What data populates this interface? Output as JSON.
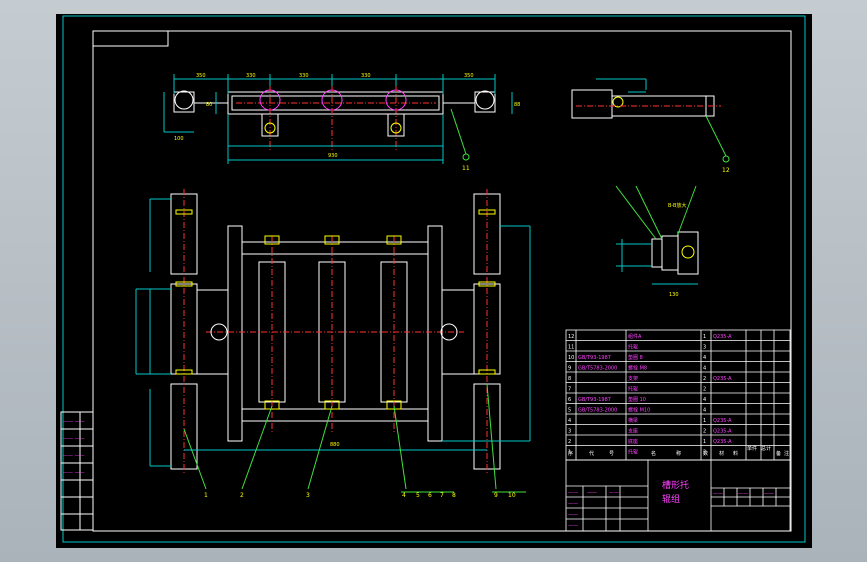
{
  "title_block": {
    "drawing_title_line1": "槽形托",
    "drawing_title_line2": "辊组"
  },
  "parts_list": {
    "header": [
      "序",
      "代",
      "号",
      "名",
      "称",
      "数",
      "材",
      "料",
      "单件",
      "总计",
      "备",
      "注"
    ],
    "rows": [
      {
        "no": "12",
        "code": "",
        "name": "组件A",
        "qty": "1",
        "material": "Q235-A"
      },
      {
        "no": "11",
        "code": "",
        "name": "托辊",
        "qty": "3",
        "material": ""
      },
      {
        "no": "10",
        "code": "GB/T93-1987",
        "name": "垫圈 8",
        "qty": "4",
        "material": ""
      },
      {
        "no": "9",
        "code": "GB/T5783-2000",
        "name": "螺栓 M8",
        "qty": "4",
        "material": ""
      },
      {
        "no": "8",
        "code": "",
        "name": "支架",
        "qty": "2",
        "material": "Q235-A"
      },
      {
        "no": "7",
        "code": "",
        "name": "托辊",
        "qty": "2",
        "material": ""
      },
      {
        "no": "6",
        "code": "GB/T93-1987",
        "name": "垫圈 10",
        "qty": "4",
        "material": ""
      },
      {
        "no": "5",
        "code": "GB/T5783-2000",
        "name": "螺栓 M10",
        "qty": "4",
        "material": ""
      },
      {
        "no": "4",
        "code": "",
        "name": "横梁",
        "qty": "1",
        "material": "Q235-A"
      },
      {
        "no": "3",
        "code": "",
        "name": "支座",
        "qty": "2",
        "material": "Q235-A"
      },
      {
        "no": "2",
        "code": "",
        "name": "底座",
        "qty": "1",
        "material": "Q235-A"
      },
      {
        "no": "1",
        "code": "",
        "name": "托辊",
        "qty": "2",
        "material": ""
      }
    ]
  },
  "balloons": [
    "1",
    "2",
    "3",
    "4",
    "5",
    "6",
    "7",
    "8",
    "9",
    "10",
    "11",
    "12"
  ],
  "dimensions": {
    "top_view": [
      "350",
      "330",
      "330",
      "330",
      "350",
      "100",
      "80",
      "88"
    ],
    "top_view_total": "930",
    "side_view": [
      "130"
    ],
    "section_label": "B-B放大",
    "plan_view_total": "880"
  },
  "colors": {
    "background": "#000000",
    "outline": "#ffffff",
    "dimension": "#00c8c8",
    "centerline": "#ff3030",
    "leader": "#40e040",
    "annotation": "#ff40ff",
    "highlight": "#ffff00"
  }
}
